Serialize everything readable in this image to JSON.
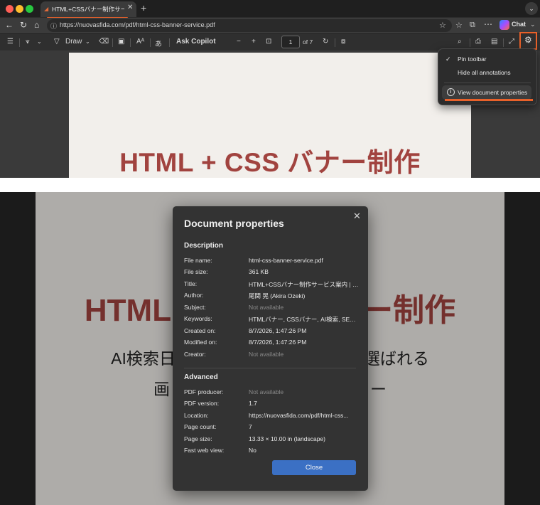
{
  "browser": {
    "tab_title": "HTML+CSSバナー制作サービス案内",
    "new_tab": "+",
    "url": "https://nuovasfida.com/pdf/html-css-banner-service.pdf",
    "chat_label": "Chat"
  },
  "pdf_toolbar": {
    "draw_label": "Draw",
    "ask_copilot": "Ask Copilot",
    "current_page": "1",
    "page_total": "of 7"
  },
  "pdf_page": {
    "heading": "HTML + CSS バナー制作",
    "heading_dialog_view": "HTML",
    "heading_right": "ー制作",
    "line1_left": "AI検索日",
    "line1_right": "選ばれる",
    "line2_left": "画",
    "line2_right": "ー"
  },
  "settings_menu": {
    "items": [
      {
        "label": "Pin toolbar",
        "checked": true
      },
      {
        "label": "Hide all annotations",
        "checked": false
      },
      {
        "label": "View document properties",
        "checked": false
      }
    ]
  },
  "dialog": {
    "title": "Document properties",
    "description_heading": "Description",
    "description": [
      {
        "label": "File name:",
        "value": "html-css-banner-service.pdf"
      },
      {
        "label": "File size:",
        "value": "361 KB"
      },
      {
        "label": "Title:",
        "value": "HTML+CSSバナー制作サービス案内 | N..."
      },
      {
        "label": "Author:",
        "value": "尾関 晃 (Akira Ozeki)"
      },
      {
        "label": "Subject:",
        "value": "Not available"
      },
      {
        "label": "Keywords:",
        "value": "HTMLバナー, CSSバナー, AI検索, SEO, ..."
      },
      {
        "label": "Created on:",
        "value": "8/7/2026, 1:47:26 PM"
      },
      {
        "label": "Modified on:",
        "value": "8/7/2026, 1:47:26 PM"
      },
      {
        "label": "Creator:",
        "value": "Not available"
      }
    ],
    "advanced_heading": "Advanced",
    "advanced": [
      {
        "label": "PDF producer:",
        "value": "Not available"
      },
      {
        "label": "PDF version:",
        "value": "1.7"
      },
      {
        "label": "Location:",
        "value": "https://nuovasfida.com/pdf/html-css..."
      },
      {
        "label": "Page count:",
        "value": "7"
      },
      {
        "label": "Page size:",
        "value": "13.33 × 10.00 in (landscape)"
      },
      {
        "label": "Fast web view:",
        "value": "No"
      }
    ],
    "close_label": "Close"
  },
  "colors": {
    "highlight": "#e8612a",
    "primary_button": "#3b70c4",
    "heading_red": "#a1433f"
  }
}
